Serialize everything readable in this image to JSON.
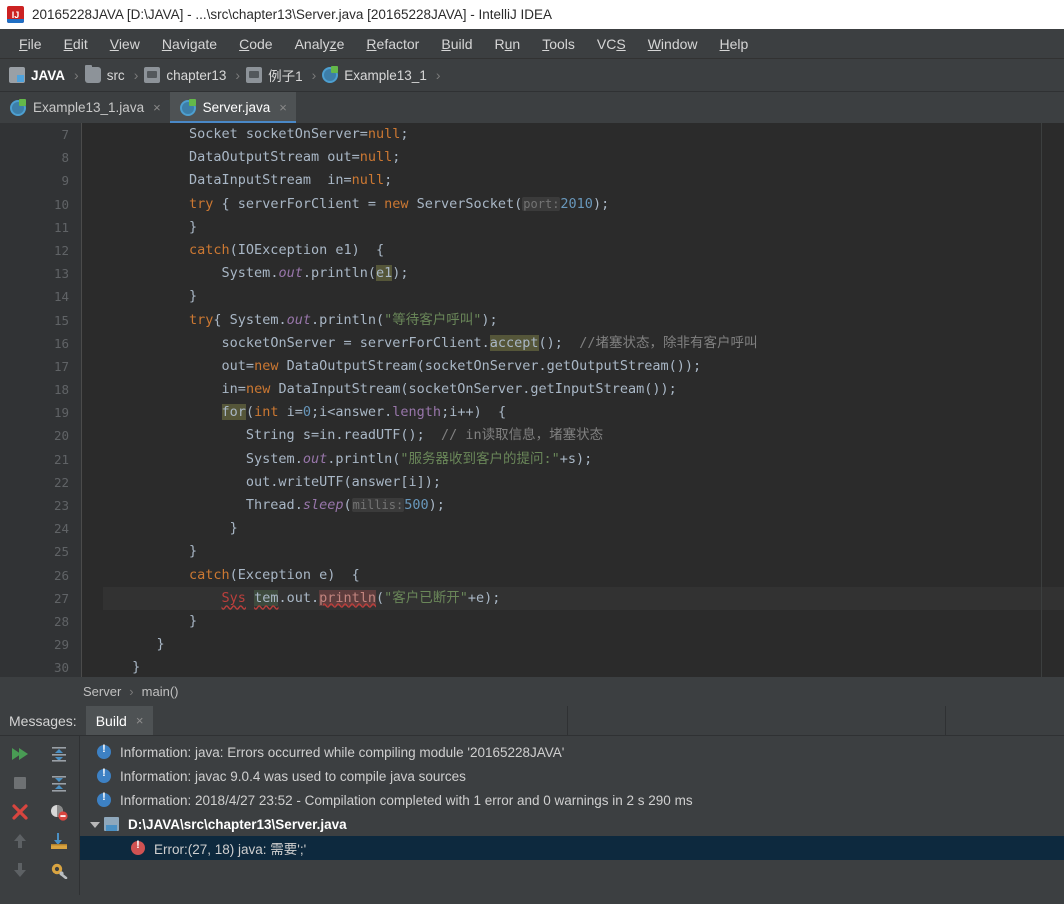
{
  "titlebar": {
    "title": "20165228JAVA [D:\\JAVA] - ...\\src\\chapter13\\Server.java [20165228JAVA] - IntelliJ IDEA",
    "icon": "intellij-idea-logo"
  },
  "menubar": {
    "items": [
      "File",
      "Edit",
      "View",
      "Navigate",
      "Code",
      "Analyze",
      "Refactor",
      "Build",
      "Run",
      "Tools",
      "VCS",
      "Window",
      "Help"
    ]
  },
  "breadcrumb": {
    "items": [
      {
        "label": "JAVA",
        "icon": "module-icon"
      },
      {
        "label": "src",
        "icon": "source-folder-icon"
      },
      {
        "label": "chapter13",
        "icon": "folder-icon"
      },
      {
        "label": "例子1",
        "icon": "folder-icon"
      },
      {
        "label": "Example13_1",
        "icon": "java-class-icon"
      }
    ],
    "separator": "›"
  },
  "tabs": [
    {
      "label": "Example13_1.java",
      "icon": "java-class-icon",
      "active": false,
      "close": "×"
    },
    {
      "label": "Server.java",
      "icon": "java-class-icon",
      "active": true,
      "close": "×"
    }
  ],
  "editor": {
    "first_line_number": 7,
    "lines": [
      {
        "n": 7,
        "text": "Socket socketOnServer=null;"
      },
      {
        "n": 8,
        "text": "DataOutputStream out=null;"
      },
      {
        "n": 9,
        "text": "DataInputStream  in=null;"
      },
      {
        "n": 10,
        "text": "try { serverForClient = new ServerSocket( port: 2010);"
      },
      {
        "n": 11,
        "text": "}"
      },
      {
        "n": 12,
        "text": "catch(IOException e1) {"
      },
      {
        "n": 13,
        "text": "System. out.println(e1);"
      },
      {
        "n": 14,
        "text": "}"
      },
      {
        "n": 15,
        "text": "try { System. out.println(\"等待客户呼叫\");"
      },
      {
        "n": 16,
        "text": "socketOnServer = serverForClient.accept(); //堵塞状态，除非有客户呼叫"
      },
      {
        "n": 17,
        "text": "out=new DataOutputStream(socketOnServer.getOutputStream());"
      },
      {
        "n": 18,
        "text": "in=new DataInputStream(socketOnServer.getInputStream());"
      },
      {
        "n": 19,
        "text": "for(int i=0;i<answer.length;i++) {"
      },
      {
        "n": 20,
        "text": "String s=in.readUTF(); // in读取信息，堵塞状态"
      },
      {
        "n": 21,
        "text": "System. out.println(\"服务器收到客户的提问:\"+s);"
      },
      {
        "n": 22,
        "text": "out.writeUTF(answer[i]);"
      },
      {
        "n": 23,
        "text": "Thread.sleep( millis: 500);"
      },
      {
        "n": 24,
        "text": "}"
      },
      {
        "n": 25,
        "text": "}"
      },
      {
        "n": 26,
        "text": "catch(Exception e) {"
      },
      {
        "n": 27,
        "text": "Sys tem.out.println(\"客户已断开\"+e);"
      },
      {
        "n": 28,
        "text": "}"
      },
      {
        "n": 29,
        "text": "}"
      },
      {
        "n": 30,
        "text": "}"
      }
    ],
    "tokens": {
      "param_hint_port": "port:",
      "param_hint_millis": "millis:",
      "port_value": "2010",
      "millis_value": "500",
      "str_wait": "\"等待客户呼叫\"",
      "str_question": "\"服务器收到客户的提问:\"",
      "str_disconnect": "\"客户已断开\"",
      "comment_block": "//堵塞状态，除非有客户呼叫",
      "comment_read": "// in读取信息，堵塞状态"
    },
    "colors": {
      "background": "#2b2b2b",
      "gutter": "#313335",
      "keyword": "#cc7832",
      "string": "#6a8759",
      "number": "#6897bb",
      "comment": "#808080",
      "field": "#9876aa",
      "text": "#a9b7c6",
      "error": "#bc3f3c",
      "search_highlight": "#555639"
    }
  },
  "editor_breadcrumb": {
    "items": [
      "Server",
      "main()"
    ],
    "separator": "›"
  },
  "messages_panel": {
    "label": "Messages:",
    "tab_label": "Build",
    "tab_close": "×",
    "toolbar": [
      {
        "name": "rerun-icon",
        "glyph": "▶▶"
      },
      {
        "name": "collapse-all-icon",
        "glyph": "collapse"
      },
      {
        "name": "stop-icon",
        "glyph": "■"
      },
      {
        "name": "expand-all-icon",
        "glyph": "expand"
      },
      {
        "name": "close-icon",
        "glyph": "✕"
      },
      {
        "name": "hide-warnings-icon",
        "glyph": "warnings"
      },
      {
        "name": "previous-occurrence-icon",
        "glyph": "↑"
      },
      {
        "name": "export-icon",
        "glyph": "⬇"
      },
      {
        "name": "next-occurrence-icon",
        "glyph": "↓"
      },
      {
        "name": "settings-icon",
        "glyph": "⚙"
      }
    ],
    "rows": [
      {
        "type": "info",
        "text": "Information: java: Errors occurred while compiling module '20165228JAVA'",
        "indent": 0,
        "selected": false,
        "bold": false
      },
      {
        "type": "info",
        "text": "Information: javac 9.0.4 was used to compile java sources",
        "indent": 0,
        "selected": false,
        "bold": false
      },
      {
        "type": "info",
        "text": "Information: 2018/4/27 23:52 - Compilation completed with 1 error and 0 warnings in 2 s 290 ms",
        "indent": 0,
        "selected": false,
        "bold": false
      },
      {
        "type": "file",
        "text": "D:\\JAVA\\src\\chapter13\\Server.java",
        "indent": 0,
        "selected": false,
        "bold": true,
        "expanded": true
      },
      {
        "type": "error",
        "text": "Error:(27, 18)  java: 需要';'",
        "indent": 1,
        "selected": true,
        "bold": false
      }
    ]
  }
}
